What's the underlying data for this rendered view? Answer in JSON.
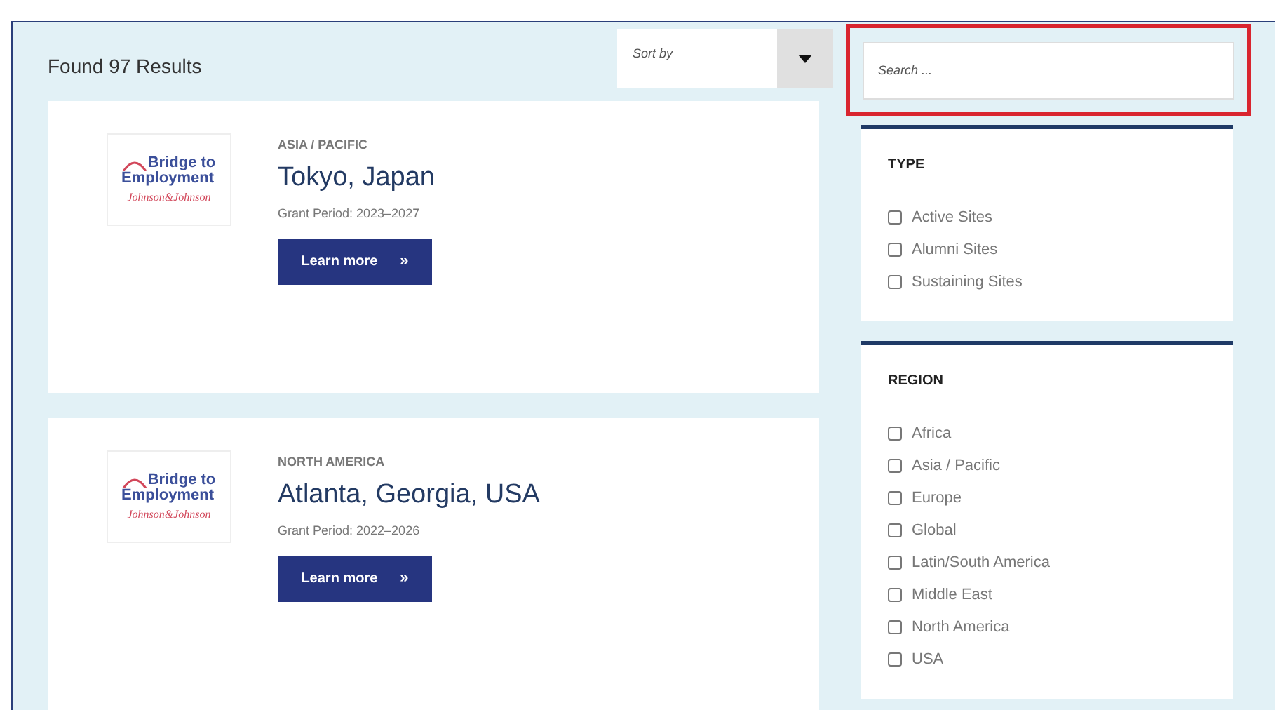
{
  "results_count": "Found 97 Results",
  "sort": {
    "placeholder": "Sort by"
  },
  "search": {
    "placeholder": "Search ...",
    "highlighted": true
  },
  "results": [
    {
      "logo": {
        "line_1": "Bridge to",
        "line_2": "Employment",
        "sponsor": "Johnson&Johnson"
      },
      "region": "ASIA / PACIFIC",
      "title": "Tokyo, Japan",
      "grant_period": "Grant Period: 2023–2027",
      "button": "Learn more",
      "button_icon": "»"
    },
    {
      "logo": {
        "line_1": "Bridge to",
        "line_2": "Employment",
        "sponsor": "Johnson&Johnson"
      },
      "region": "NORTH AMERICA",
      "title": "Atlanta, Georgia, USA",
      "grant_period": "Grant Period: 2022–2026",
      "button": "Learn more",
      "button_icon": "»"
    }
  ],
  "filters": [
    {
      "title": "TYPE",
      "options": [
        {
          "label": "Active Sites",
          "checked": false
        },
        {
          "label": "Alumni Sites",
          "checked": false
        },
        {
          "label": "Sustaining Sites",
          "checked": false
        }
      ]
    },
    {
      "title": "REGION",
      "options": [
        {
          "label": "Africa",
          "checked": false
        },
        {
          "label": "Asia / Pacific",
          "checked": false
        },
        {
          "label": "Europe",
          "checked": false
        },
        {
          "label": "Global",
          "checked": false
        },
        {
          "label": "Latin/South America",
          "checked": false
        },
        {
          "label": "Middle East",
          "checked": false
        },
        {
          "label": "North America",
          "checked": false
        },
        {
          "label": "USA",
          "checked": false
        }
      ]
    }
  ]
}
